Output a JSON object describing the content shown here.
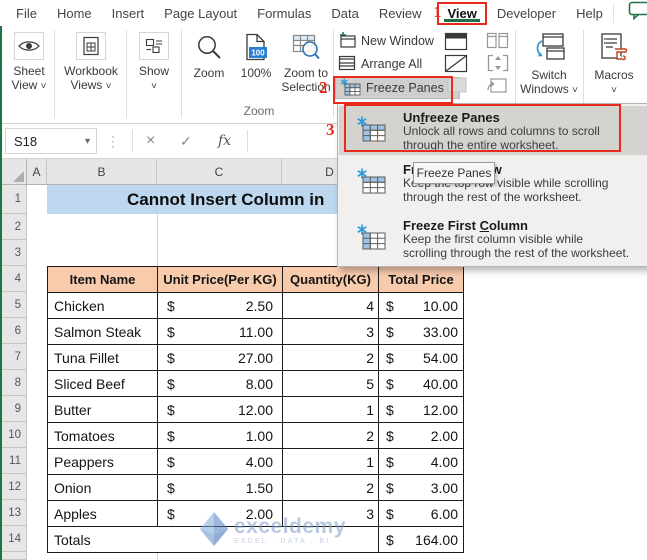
{
  "colors": {
    "excel_green": "#217346",
    "annotation_red": "#E8291D",
    "title_fill": "#BDD7EE",
    "table_header_fill": "#F8CBAD",
    "badge_blue": "#2B7CD3",
    "freeze_icon_cell_blue": "#9DC3E6",
    "freeze_icon_asterisk_blue": "#2E9BD5"
  },
  "icons": {
    "chevron": "˅",
    "name_box_arrow": "▾",
    "ellipsis": "⋮",
    "cancel": "×",
    "enter": "✓",
    "fx": "fx"
  },
  "annotations": {
    "one": "1",
    "two": "2",
    "three": "3"
  },
  "tabbar": {
    "tabs": [
      "File",
      "Home",
      "Insert",
      "Page Layout",
      "Formulas",
      "Data",
      "Review",
      "View",
      "Developer",
      "Help"
    ],
    "active_tab": "View"
  },
  "ribbon": {
    "sheet_view_l1": "Sheet",
    "sheet_view_l2": "View",
    "workbook_views_l1": "Workbook",
    "workbook_views_l2": "Views",
    "show_label": "Show",
    "zoom_label": "Zoom",
    "hundred_label": "100%",
    "badge_100": "100",
    "zoom_to_l1": "Zoom to",
    "zoom_to_l2": "Selection",
    "zoom_group_label": "Zoom",
    "new_window_label": "New Window",
    "arrange_all_label": "Arrange All",
    "freeze_panes_label": "Freeze Panes",
    "switch_l1": "Switch",
    "switch_l2": "Windows",
    "macros_label": "Macros"
  },
  "formula_bar": {
    "name_box": "S18"
  },
  "menu": {
    "tooltip": "Freeze Panes",
    "items": [
      {
        "pre": "Un",
        "accel": "f",
        "post": "reeze Panes",
        "desc1": "Unlock all rows and columns to scroll",
        "desc2": "through the entire worksheet."
      },
      {
        "pre": "Freeze Top ",
        "accel": "R",
        "post": "ow",
        "desc1": "Keep the top row visible while scrolling",
        "desc2": "through the rest of the worksheet."
      },
      {
        "pre": "Freeze First ",
        "accel": "C",
        "post": "olumn",
        "desc1": "Keep the first column visible while",
        "desc2": "scrolling through the rest of the worksheet."
      }
    ]
  },
  "sheet": {
    "title": "Cannot Insert Column in",
    "col_headers": [
      "A",
      "B",
      "C",
      "D"
    ],
    "row_headers": [
      "1",
      "2",
      "3",
      "4",
      "5",
      "6",
      "7",
      "8",
      "9",
      "10",
      "11",
      "12",
      "13",
      "14"
    ],
    "table_headers": [
      "Item Name",
      "Unit Price(Per KG)",
      "Quantity(KG)",
      "Total Price"
    ],
    "rows": [
      {
        "item": "Chicken",
        "cur1": "$",
        "unit": "2.50",
        "qty": "4",
        "cur2": "$",
        "total": "10.00"
      },
      {
        "item": "Salmon Steak",
        "cur1": "$",
        "unit": "11.00",
        "qty": "3",
        "cur2": "$",
        "total": "33.00"
      },
      {
        "item": "Tuna Fillet",
        "cur1": "$",
        "unit": "27.00",
        "qty": "2",
        "cur2": "$",
        "total": "54.00"
      },
      {
        "item": "Sliced Beef",
        "cur1": "$",
        "unit": "8.00",
        "qty": "5",
        "cur2": "$",
        "total": "40.00"
      },
      {
        "item": "Butter",
        "cur1": "$",
        "unit": "12.00",
        "qty": "1",
        "cur2": "$",
        "total": "12.00"
      },
      {
        "item": "Tomatoes",
        "cur1": "$",
        "unit": "1.00",
        "qty": "2",
        "cur2": "$",
        "total": "2.00"
      },
      {
        "item": "Peappers",
        "cur1": "$",
        "unit": "4.00",
        "qty": "1",
        "cur2": "$",
        "total": "4.00"
      },
      {
        "item": "Onion",
        "cur1": "$",
        "unit": "1.50",
        "qty": "2",
        "cur2": "$",
        "total": "3.00"
      },
      {
        "item": "Apples",
        "cur1": "$",
        "unit": "2.00",
        "qty": "3",
        "cur2": "$",
        "total": "6.00"
      }
    ],
    "totals_row": {
      "item": "Totals",
      "cur2": "$",
      "total": "164.00"
    },
    "watermark_name": "exceldemy",
    "watermark_tagline": "EXCEL · DATA · BI"
  }
}
